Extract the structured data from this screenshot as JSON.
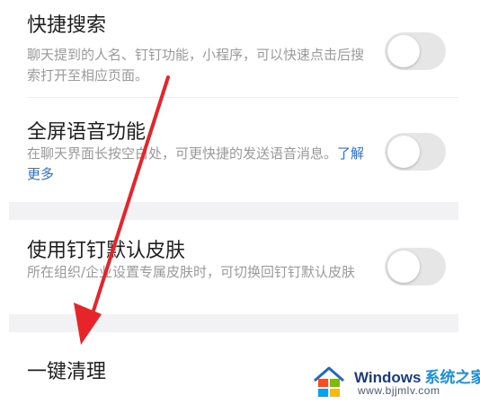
{
  "settings": {
    "quick_search": {
      "title": "快捷搜索",
      "desc": "聊天提到的人名、钉钉功能，小程序，可以快速点击后搜索打开至相应页面。",
      "enabled": false
    },
    "fullscreen_voice": {
      "title": "全屏语音功能",
      "desc": "在聊天界面长按空白处，可更快捷的发送语音消息。",
      "learn_more": "了解更多",
      "enabled": false
    },
    "default_skin": {
      "title": "使用钉钉默认皮肤",
      "desc": "所在组织/企业设置专属皮肤时，可切换回钉钉默认皮肤",
      "enabled": false
    },
    "one_click_clean": {
      "title": "一键清理"
    }
  },
  "annotation": {
    "arrow_color": "#e8242b"
  },
  "watermark": {
    "brand": "Windows",
    "brand_cn": "系统之家",
    "url": "www.bjjmlv.com"
  },
  "colors": {
    "toggle_off": "#e6e6e6",
    "section_gap": "#f2f2f4",
    "link": "#2a6fe0"
  }
}
